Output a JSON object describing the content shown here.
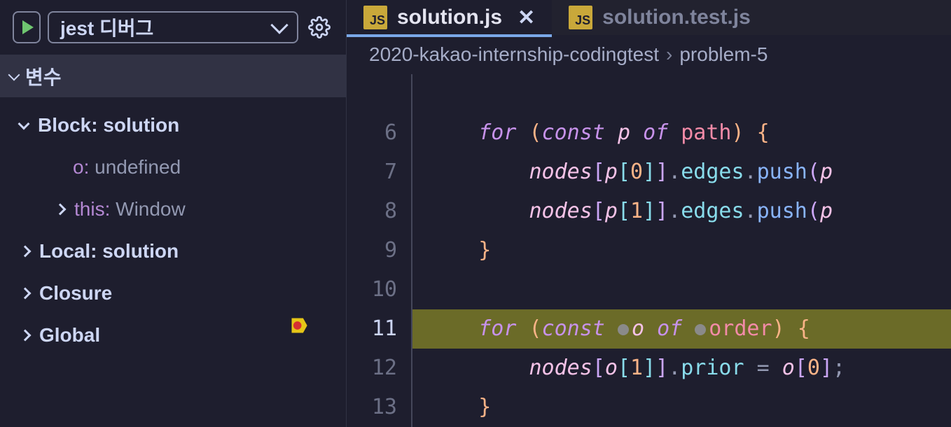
{
  "toolbar": {
    "config_name": "jest 디버그"
  },
  "variables": {
    "section_title": "변수",
    "scopes": [
      {
        "label": "Block: solution",
        "expanded": true,
        "bold": true
      },
      {
        "label": "Local: solution",
        "expanded": false,
        "bold": true
      },
      {
        "label": "Closure",
        "expanded": false,
        "bold": true
      },
      {
        "label": "Global",
        "expanded": false,
        "bold": true
      }
    ],
    "block_children": [
      {
        "key": "o:",
        "value": "undefined",
        "caret": false
      },
      {
        "key": "this:",
        "value": "Window",
        "caret": true
      }
    ]
  },
  "tabs": [
    {
      "filename": "solution.js",
      "active": true
    },
    {
      "filename": "solution.test.js",
      "active": false
    }
  ],
  "breadcrumb": {
    "parts": [
      "2020-kakao-internship-codingtest",
      "problem-5"
    ]
  },
  "editor": {
    "lines": [
      {
        "num": "",
        "tokens": []
      },
      {
        "num": "6",
        "tokens": [
          {
            "t": "    ",
            "c": ""
          },
          {
            "t": "for",
            "c": "kw"
          },
          {
            "t": " ",
            "c": ""
          },
          {
            "t": "(",
            "c": "bracket1"
          },
          {
            "t": "const",
            "c": "kw"
          },
          {
            "t": " ",
            "c": ""
          },
          {
            "t": "p",
            "c": "var"
          },
          {
            "t": " ",
            "c": ""
          },
          {
            "t": "of",
            "c": "kw"
          },
          {
            "t": " ",
            "c": ""
          },
          {
            "t": "path",
            "c": "param"
          },
          {
            "t": ")",
            "c": "bracket1"
          },
          {
            "t": " ",
            "c": ""
          },
          {
            "t": "{",
            "c": "bracket1"
          }
        ]
      },
      {
        "num": "7",
        "tokens": [
          {
            "t": "        ",
            "c": ""
          },
          {
            "t": "nodes",
            "c": "var"
          },
          {
            "t": "[",
            "c": "bracket2"
          },
          {
            "t": "p",
            "c": "var"
          },
          {
            "t": "[",
            "c": "bracket3"
          },
          {
            "t": "0",
            "c": "num"
          },
          {
            "t": "]",
            "c": "bracket3"
          },
          {
            "t": "]",
            "c": "bracket2"
          },
          {
            "t": ".",
            "c": "punc"
          },
          {
            "t": "edges",
            "c": "prop"
          },
          {
            "t": ".",
            "c": "punc"
          },
          {
            "t": "push",
            "c": "method"
          },
          {
            "t": "(",
            "c": "bracket2"
          },
          {
            "t": "p",
            "c": "var"
          }
        ]
      },
      {
        "num": "8",
        "tokens": [
          {
            "t": "        ",
            "c": ""
          },
          {
            "t": "nodes",
            "c": "var"
          },
          {
            "t": "[",
            "c": "bracket2"
          },
          {
            "t": "p",
            "c": "var"
          },
          {
            "t": "[",
            "c": "bracket3"
          },
          {
            "t": "1",
            "c": "num"
          },
          {
            "t": "]",
            "c": "bracket3"
          },
          {
            "t": "]",
            "c": "bracket2"
          },
          {
            "t": ".",
            "c": "punc"
          },
          {
            "t": "edges",
            "c": "prop"
          },
          {
            "t": ".",
            "c": "punc"
          },
          {
            "t": "push",
            "c": "method"
          },
          {
            "t": "(",
            "c": "bracket2"
          },
          {
            "t": "p",
            "c": "var"
          }
        ]
      },
      {
        "num": "9",
        "tokens": [
          {
            "t": "    ",
            "c": ""
          },
          {
            "t": "}",
            "c": "bracket1"
          }
        ]
      },
      {
        "num": "10",
        "tokens": []
      },
      {
        "num": "11",
        "highlighted": true,
        "breakpoint": true,
        "tokens": [
          {
            "t": "    ",
            "c": ""
          },
          {
            "t": "for",
            "c": "kw"
          },
          {
            "t": " ",
            "c": ""
          },
          {
            "t": "(",
            "c": "bracket1"
          },
          {
            "t": "const",
            "c": "kw"
          },
          {
            "t": " ",
            "c": ""
          },
          {
            "t": "",
            "c": "dot"
          },
          {
            "t": "o",
            "c": "var"
          },
          {
            "t": " ",
            "c": ""
          },
          {
            "t": "of",
            "c": "kw"
          },
          {
            "t": " ",
            "c": ""
          },
          {
            "t": "",
            "c": "dot"
          },
          {
            "t": "order",
            "c": "param"
          },
          {
            "t": ")",
            "c": "bracket1"
          },
          {
            "t": " ",
            "c": ""
          },
          {
            "t": "{",
            "c": "bracket1"
          }
        ]
      },
      {
        "num": "12",
        "tokens": [
          {
            "t": "        ",
            "c": ""
          },
          {
            "t": "nodes",
            "c": "var"
          },
          {
            "t": "[",
            "c": "bracket2"
          },
          {
            "t": "o",
            "c": "var"
          },
          {
            "t": "[",
            "c": "bracket3"
          },
          {
            "t": "1",
            "c": "num"
          },
          {
            "t": "]",
            "c": "bracket3"
          },
          {
            "t": "]",
            "c": "bracket2"
          },
          {
            "t": ".",
            "c": "punc"
          },
          {
            "t": "prior",
            "c": "prop"
          },
          {
            "t": " = ",
            "c": "punc"
          },
          {
            "t": "o",
            "c": "var"
          },
          {
            "t": "[",
            "c": "bracket2"
          },
          {
            "t": "0",
            "c": "num"
          },
          {
            "t": "]",
            "c": "bracket2"
          },
          {
            "t": ";",
            "c": "punc"
          }
        ]
      },
      {
        "num": "13",
        "tokens": [
          {
            "t": "    ",
            "c": ""
          },
          {
            "t": "}",
            "c": "bracket1"
          }
        ]
      }
    ]
  }
}
